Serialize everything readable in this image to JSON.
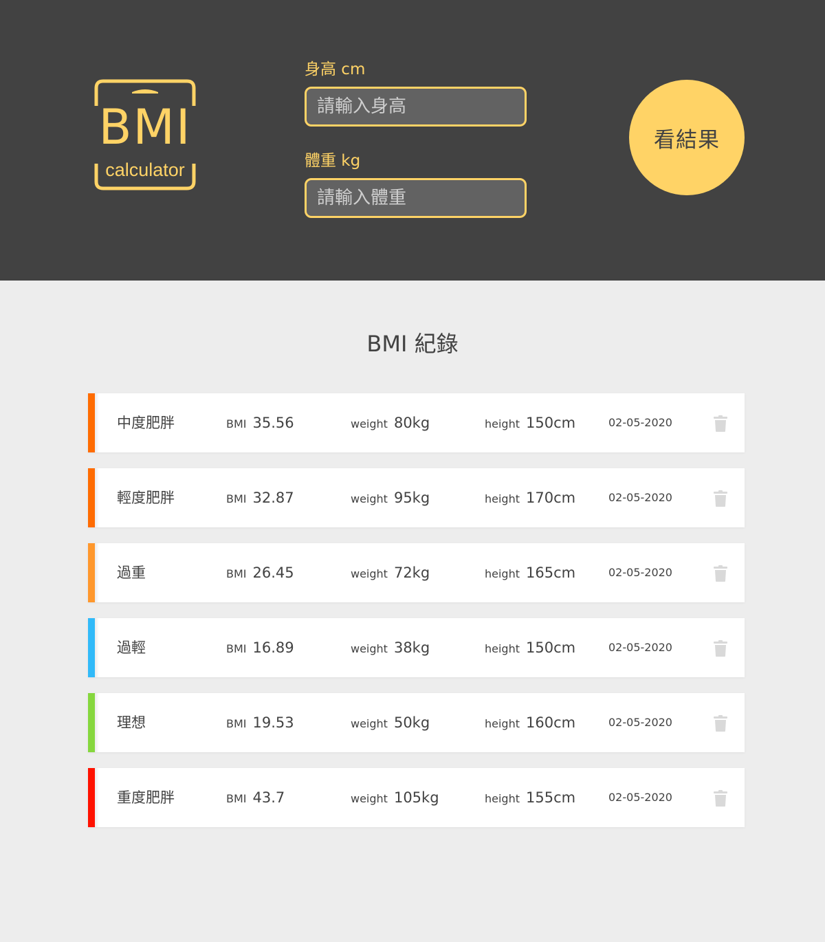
{
  "logo": {
    "title": "BMI",
    "subtitle": "calculator",
    "color": "#FFD366"
  },
  "form": {
    "height_label": "身高 cm",
    "height_placeholder": "請輸入身高",
    "weight_label": "體重 kg",
    "weight_placeholder": "請輸入體重",
    "submit_label": "看結果"
  },
  "records": {
    "title": "BMI 紀錄",
    "bmi_label": "BMI",
    "weight_label": "weight",
    "height_label": "height",
    "items": [
      {
        "status": "中度肥胖",
        "bmi": "35.56",
        "weight": "80kg",
        "height": "150cm",
        "date": "02-05-2020",
        "color": "#FF6C02"
      },
      {
        "status": "輕度肥胖",
        "bmi": "32.87",
        "weight": "95kg",
        "height": "170cm",
        "date": "02-05-2020",
        "color": "#FF6C02"
      },
      {
        "status": "過重",
        "bmi": "26.45",
        "weight": "72kg",
        "height": "165cm",
        "date": "02-05-2020",
        "color": "#FF982D"
      },
      {
        "status": "過輕",
        "bmi": "16.89",
        "weight": "38kg",
        "height": "150cm",
        "date": "02-05-2020",
        "color": "#31BAF9"
      },
      {
        "status": "理想",
        "bmi": "19.53",
        "weight": "50kg",
        "height": "160cm",
        "date": "02-05-2020",
        "color": "#86D73E"
      },
      {
        "status": "重度肥胖",
        "bmi": "43.7",
        "weight": "105kg",
        "height": "155cm",
        "date": "02-05-2020",
        "color": "#FF1200"
      }
    ]
  },
  "icons": {
    "delete": "trash-icon"
  },
  "colors": {
    "header_bg": "#424242",
    "accent": "#FFD366",
    "page_bg": "#EDEDED"
  }
}
